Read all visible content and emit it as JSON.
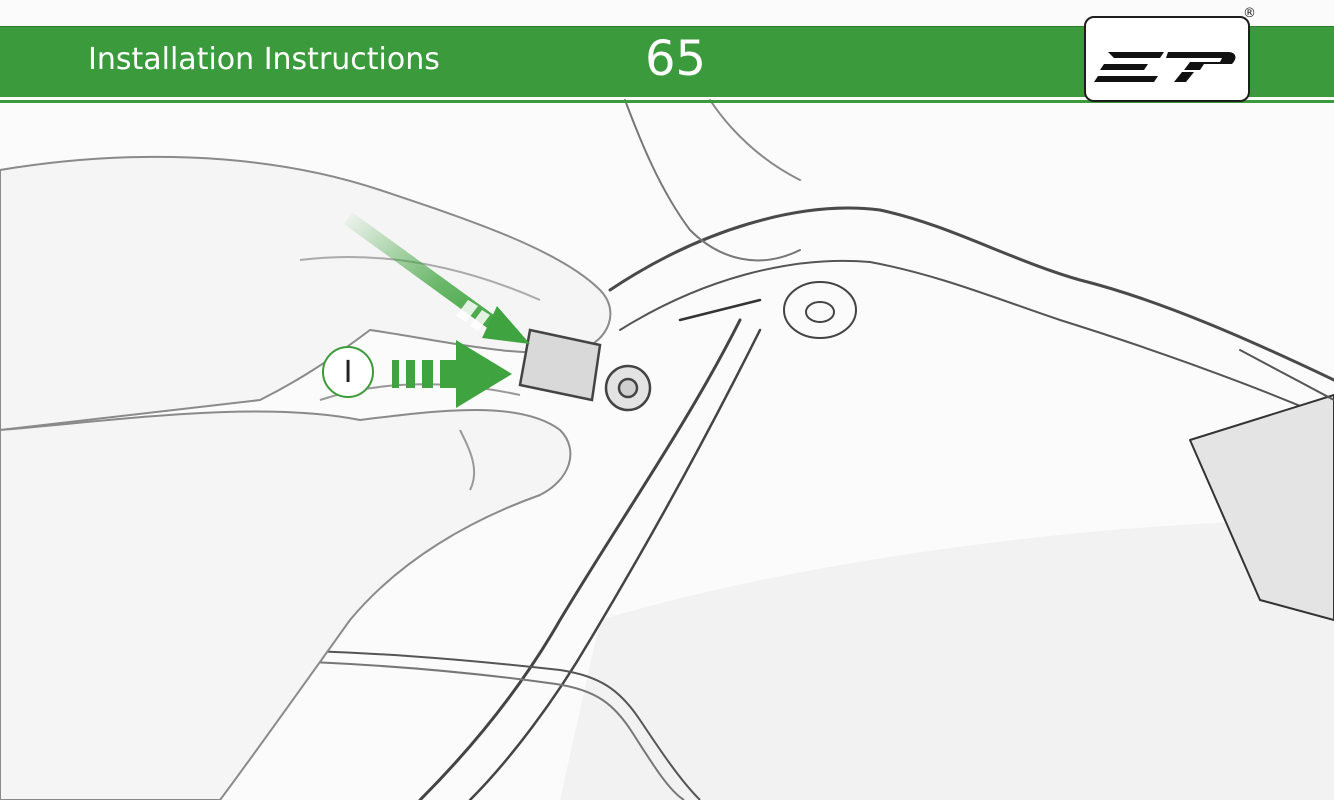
{
  "header": {
    "title": "Installation Instructions",
    "page_number": "65"
  },
  "logo": {
    "text": "ep",
    "registered_mark": "®"
  },
  "callout": {
    "step_label": "I"
  },
  "colors": {
    "brand_green": "#3a9a3c",
    "header_text": "#ffffff",
    "arrow_green": "#3fa43f"
  },
  "icons": {
    "diagonal_arrow": "arrow-down-right-icon",
    "horizontal_arrow": "arrow-right-icon"
  }
}
